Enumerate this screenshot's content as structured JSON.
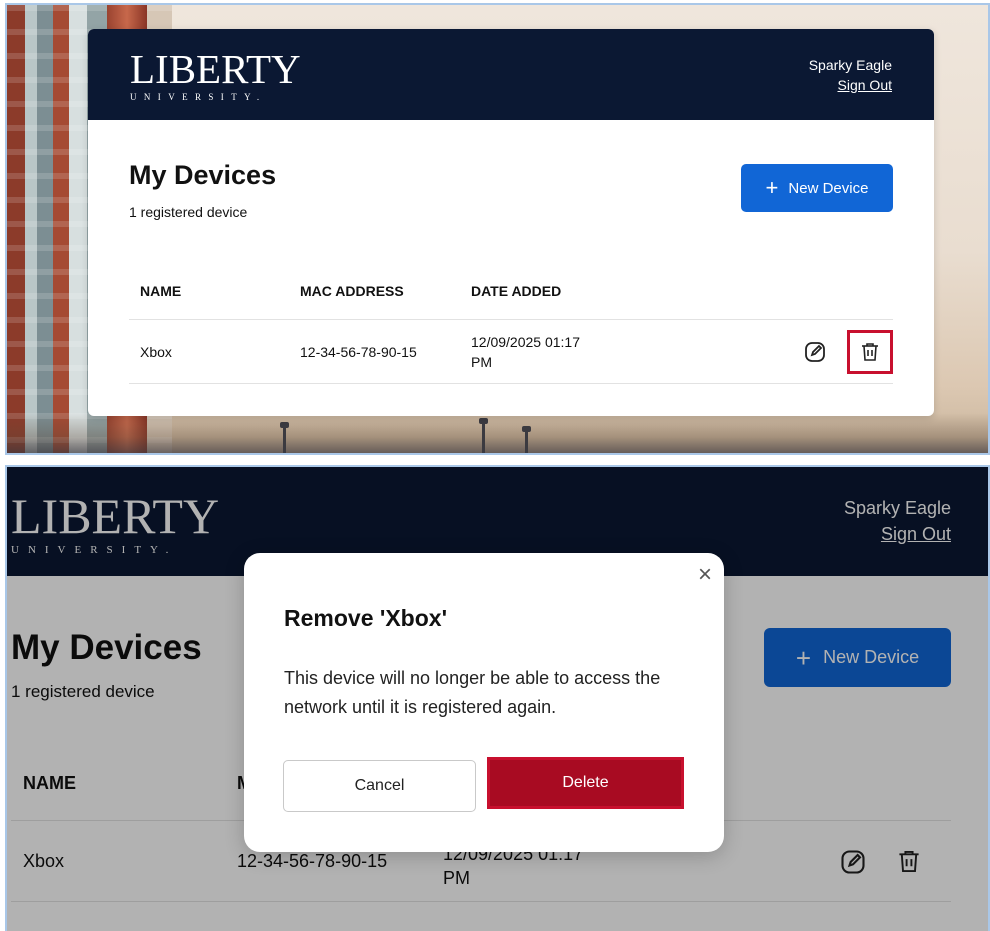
{
  "brand": {
    "logo_main": "LIBERTY",
    "logo_sub": "UNIVERSITY."
  },
  "user": {
    "name": "Sparky Eagle",
    "signout_label": "Sign Out"
  },
  "page": {
    "title": "My Devices",
    "subtitle": "1 registered device",
    "new_device_label": "New Device"
  },
  "table": {
    "headers": [
      "NAME",
      "MAC ADDRESS",
      "DATE ADDED"
    ],
    "rows": [
      {
        "name": "Xbox",
        "mac": "12-34-56-78-90-15",
        "date_line1": "12/09/2025 01:17",
        "date_line2": "PM"
      }
    ]
  },
  "modal": {
    "title": "Remove 'Xbox'",
    "message": "This device will no longer be able to access the network until it is registered again.",
    "cancel_label": "Cancel",
    "delete_label": "Delete",
    "close_glyph": "×"
  },
  "colors": {
    "header_bg": "#0b1833",
    "primary": "#1166d6",
    "danger": "#a80b22",
    "highlight": "#c8102e"
  }
}
